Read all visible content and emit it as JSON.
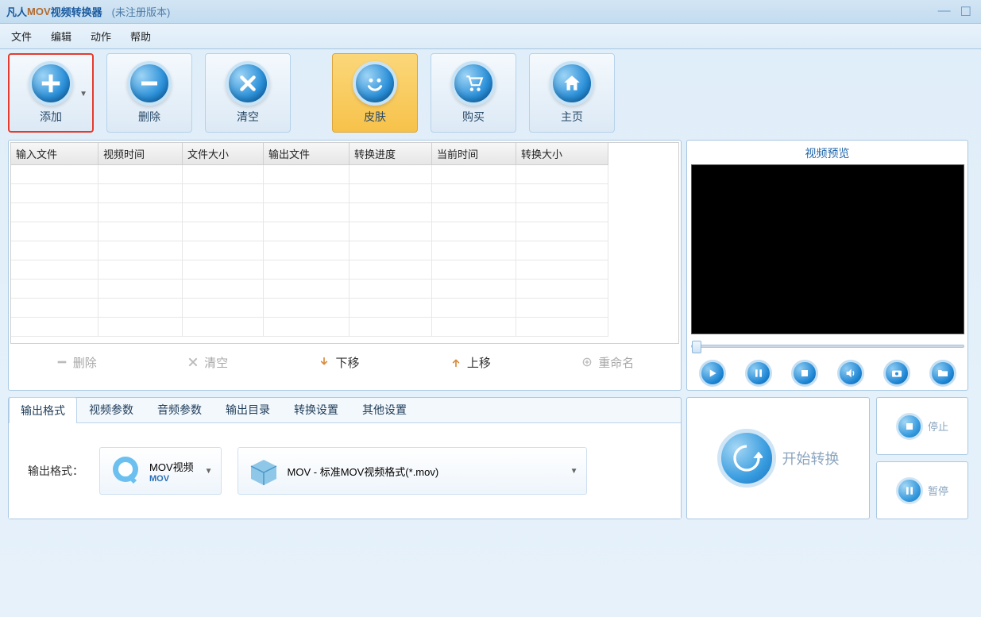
{
  "title": {
    "pre": "凡人",
    "mid": "MOV",
    "post": "视频转换器",
    "reg": "(未注册版本)"
  },
  "menu": {
    "file": "文件",
    "edit": "编辑",
    "action": "动作",
    "help": "帮助"
  },
  "toolbar": {
    "add": "添加",
    "del": "删除",
    "clear": "清空",
    "skin": "皮肤",
    "buy": "购买",
    "home": "主页"
  },
  "columns": {
    "c0": "输入文件",
    "c1": "视频时间",
    "c2": "文件大小",
    "c3": "输出文件",
    "c4": "转换进度",
    "c5": "当前时间",
    "c6": "转换大小"
  },
  "listactions": {
    "del": "删除",
    "clear": "清空",
    "down": "下移",
    "up": "上移",
    "rename": "重命名"
  },
  "preview": {
    "title": "视频预览"
  },
  "tabs": {
    "t0": "输出格式",
    "t1": "视频参数",
    "t2": "音频参数",
    "t3": "输出目录",
    "t4": "转换设置",
    "t5": "其他设置"
  },
  "output": {
    "label": "输出格式：",
    "category": "MOV视频",
    "category_sub": "MOV",
    "format": "MOV - 标准MOV视频格式(*.mov)"
  },
  "actions": {
    "start": "开始转换",
    "stop": "停止",
    "pause": "暂停"
  }
}
